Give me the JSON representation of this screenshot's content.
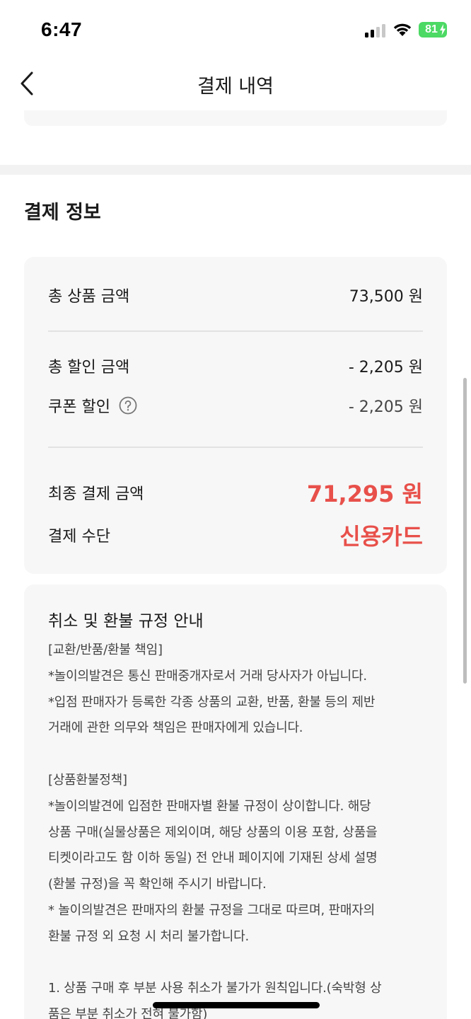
{
  "status": {
    "time": "6:47",
    "battery": "81"
  },
  "header": {
    "title": "결제 내역"
  },
  "payment_info": {
    "section_title": "결제 정보",
    "total_product_label": "총 상품 금액",
    "total_product_value": "73,500 원",
    "total_discount_label": "총 할인 금액",
    "total_discount_value": "- 2,205 원",
    "coupon_discount_label": "쿠폰 할인",
    "coupon_discount_value": "- 2,205 원",
    "final_amount_label": "최종 결제 금액",
    "final_amount_value": "71,295 원",
    "payment_method_label": "결제 수단",
    "payment_method_value": "신용카드"
  },
  "policy": {
    "title": "취소 및 환불 규정 안내",
    "lines": [
      "[교환/반품/환불 책임]",
      "*놀이의발견은 통신 판매중개자로서 거래 당사자가 아닙니다.",
      "*입점 판매자가 등록한 각종 상품의 교환, 반품, 환불 등의 제반",
      "거래에 관한 의무와 책임은 판매자에게 있습니다.",
      "",
      "[상품환불정책]",
      "*놀이의발견에 입점한 판매자별 환불 규정이 상이합니다. 해당",
      "상품 구매(실물상품은 제외이며, 해당 상품의 이용 포함, 상품을",
      "티켓이라고도 함 이하 동일) 전 안내 페이지에 기재된 상세 설명",
      "(환불 규정)을 꼭 확인해 주시기 바랍니다.",
      "* 놀이의발견은 판매자의 환불 규정을 그대로 따르며, 판매자의",
      "환불 규정 외 요청 시 처리 불가합니다.",
      "",
      "1. 상품 구매 후 부분 사용 취소가 불가가 원칙입니다.(숙박형 상",
      "품은 부분 취소가 전혀 불가함)"
    ]
  },
  "colors": {
    "accent": "#e8504a",
    "card_bg": "#f7f7f7",
    "battery": "#4cd964"
  }
}
